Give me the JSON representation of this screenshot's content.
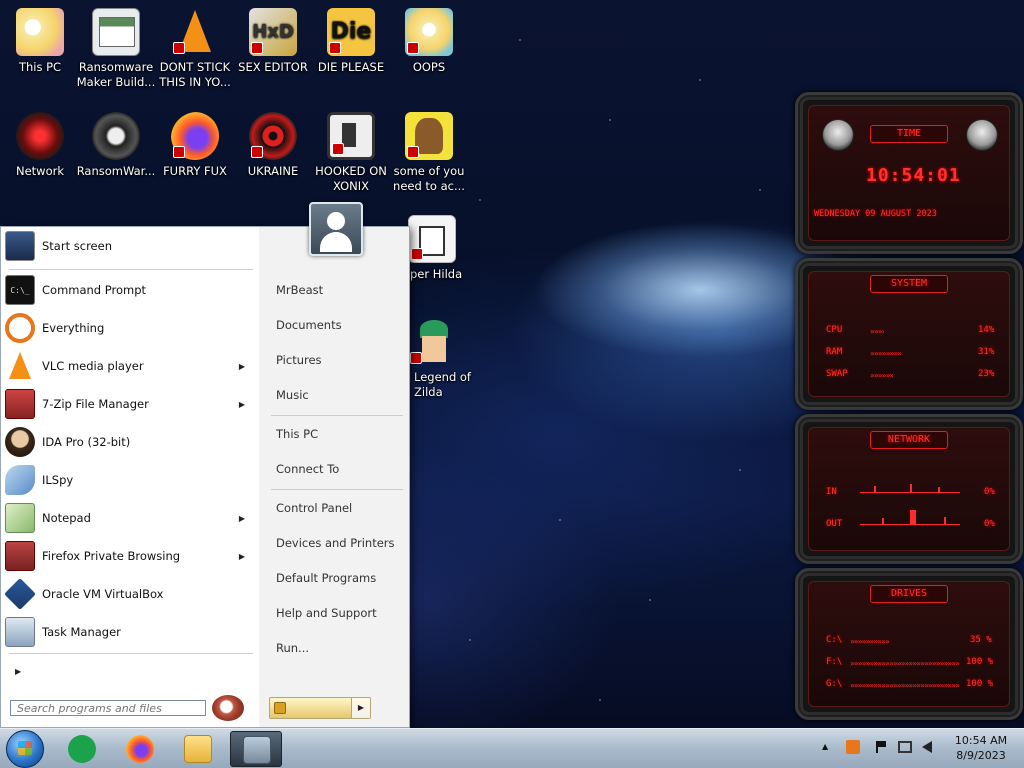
{
  "desktop": {
    "icons": [
      {
        "label": "This PC"
      },
      {
        "label": "Ransomware Maker Build..."
      },
      {
        "label": "DONT STICK THIS IN YO..."
      },
      {
        "label": "SEX EDITOR"
      },
      {
        "label": "DIE PLEASE"
      },
      {
        "label": "OOPS"
      },
      {
        "label": "Network"
      },
      {
        "label": "RansomWar..."
      },
      {
        "label": "FURRY FUX"
      },
      {
        "label": "UKRAINE"
      },
      {
        "label": "HOOKED ON XONIX"
      },
      {
        "label": "some of you need to ac..."
      },
      {
        "label": "per Hilda"
      },
      {
        "label": "Legend of Zilda"
      }
    ]
  },
  "start_menu": {
    "programs": [
      {
        "label": "Start screen",
        "arrow": ""
      },
      {
        "label": "Command Prompt",
        "arrow": ""
      },
      {
        "label": "Everything",
        "arrow": ""
      },
      {
        "label": "VLC media player",
        "arrow": "▶"
      },
      {
        "label": "7-Zip File Manager",
        "arrow": "▶"
      },
      {
        "label": "IDA Pro (32-bit)",
        "arrow": ""
      },
      {
        "label": "ILSpy",
        "arrow": ""
      },
      {
        "label": "Notepad",
        "arrow": "▶"
      },
      {
        "label": "Firefox Private Browsing",
        "arrow": "▶"
      },
      {
        "label": "Oracle VM VirtualBox",
        "arrow": ""
      },
      {
        "label": "Task Manager",
        "arrow": ""
      }
    ],
    "all_programs_arrow": "▶",
    "right_items": [
      {
        "label": "MrBeast"
      },
      {
        "label": "Documents"
      },
      {
        "label": "Pictures"
      },
      {
        "label": "Music"
      },
      {
        "label": "This PC"
      },
      {
        "label": "Connect To"
      },
      {
        "label": "Control Panel"
      },
      {
        "label": "Devices and Printers"
      },
      {
        "label": "Default Programs"
      },
      {
        "label": "Help and Support"
      },
      {
        "label": "Run..."
      }
    ],
    "search_placeholder": "Search programs and files",
    "shutdown_arrow": "▶"
  },
  "widgets": {
    "time": {
      "title": "TIME",
      "clock": "10:54:01",
      "date": "WEDNESDAY 09 AUGUST 2023"
    },
    "system": {
      "title": "SYSTEM",
      "rows": [
        {
          "label": "CPU",
          "value": "14%",
          "fill": 0.14
        },
        {
          "label": "RAM",
          "value": "31%",
          "fill": 0.31
        },
        {
          "label": "SWAP",
          "value": "23%",
          "fill": 0.23
        }
      ]
    },
    "network": {
      "title": "NETWORK",
      "in_label": "IN",
      "in_value": "0%",
      "out_label": "OUT",
      "out_value": "0%"
    },
    "drives": {
      "title": "DRIVES",
      "rows": [
        {
          "label": "C:\\",
          "value": "35 %",
          "fill": 0.35
        },
        {
          "label": "F:\\",
          "value": "100 %",
          "fill": 1.0
        },
        {
          "label": "G:\\",
          "value": "100 %",
          "fill": 1.0
        }
      ]
    }
  },
  "taskbar": {
    "tray_arrow": "▲",
    "time": "10:54 AM",
    "date": "8/9/2023"
  }
}
